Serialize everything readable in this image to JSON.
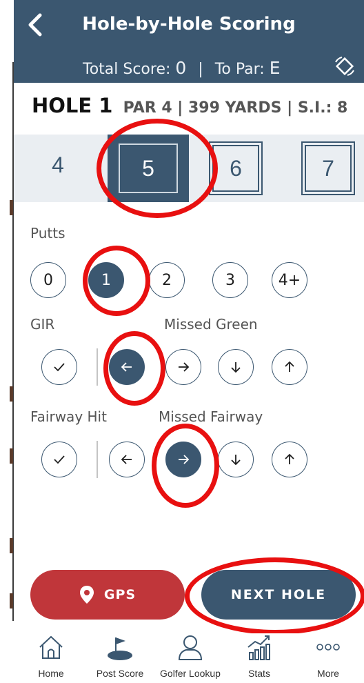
{
  "header": {
    "title": "Hole-by-Hole Scoring",
    "total_score_label": "Total Score:",
    "total_score_value": "0",
    "to_par_label": "To Par:",
    "to_par_value": "E"
  },
  "hole": {
    "name": "HOLE 1",
    "meta": "PAR 4 | 399 YARDS | S.I.: 8"
  },
  "scores": [
    "4",
    "5",
    "6",
    "7"
  ],
  "selected_score": "5",
  "putts": {
    "label": "Putts",
    "options": [
      "0",
      "1",
      "2",
      "3",
      "4+"
    ],
    "selected": "1"
  },
  "gir": {
    "label": "GIR",
    "missed_label": "Missed Green",
    "selected": "left-arrow"
  },
  "fairway": {
    "label": "Fairway Hit",
    "missed_label": "Missed Fairway",
    "selected": "right-arrow"
  },
  "buttons": {
    "gps": "GPS",
    "next": "NEXT HOLE"
  },
  "tabs": [
    {
      "label": "Home",
      "icon": "home-icon"
    },
    {
      "label": "Post Score",
      "icon": "golf-flag-icon"
    },
    {
      "label": "Golfer Lookup",
      "icon": "person-icon"
    },
    {
      "label": "Stats",
      "icon": "bar-chart-icon"
    },
    {
      "label": "More",
      "icon": "more-icon"
    }
  ],
  "colors": {
    "primary": "#3b5770",
    "gps": "#c0363a",
    "annotation": "#e81010"
  }
}
